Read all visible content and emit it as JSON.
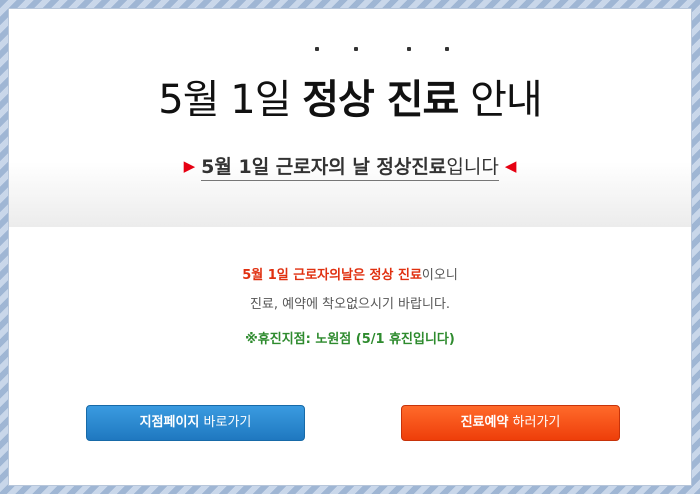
{
  "title": {
    "part1": "5월 1일 ",
    "emphasis": "정상 진료",
    "part2": " 안내"
  },
  "subtitle": {
    "left_arrow": "▶",
    "bold_text": "5월 1일 근로자의 날 정상진료",
    "normal_text": "입니다",
    "right_arrow": "◀"
  },
  "message": {
    "line1_red": "5월 1일 근로자의날은 정상 진료",
    "line1_rest": "이오니",
    "line2": "진료, 예약에 착오없으시기 바랍니다.",
    "line3": "※휴진지점: 노원점 (5/1 휴진입니다)"
  },
  "buttons": {
    "branch_bold": "지점페이지",
    "branch_rest": " 바로가기",
    "reserve_bold": "진료예약",
    "reserve_rest": " 하러가기"
  },
  "colors": {
    "accent_red": "#e60012",
    "branch_button": "#2a8bd4",
    "reserve_button": "#f24f14",
    "notice_green": "#2e8b2e"
  }
}
